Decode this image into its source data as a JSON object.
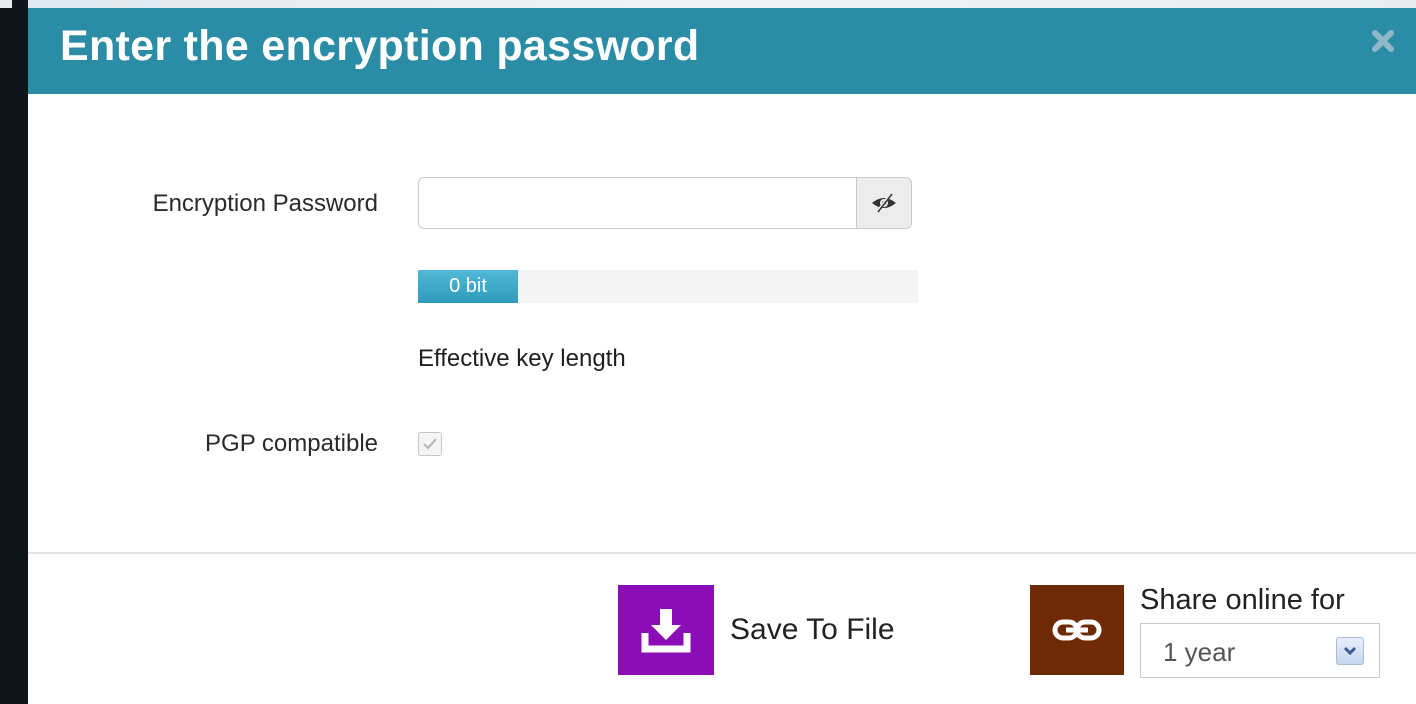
{
  "dialog": {
    "title": "Enter the encryption password",
    "header_color": "#2b8ca6"
  },
  "form": {
    "password_label": "Encryption Password",
    "password_value": "",
    "password_placeholder": "",
    "strength": {
      "text": "0 bit",
      "fill_fraction": 0.2
    },
    "key_length_label": "Effective key length",
    "pgp_label": "PGP compatible",
    "pgp_checked": true,
    "pgp_disabled": true
  },
  "footer": {
    "save_label": "Save To File",
    "save_color": "#8a0db5",
    "share_label": "Share online for",
    "share_color": "#6e2a05",
    "duration_selected": "1 year"
  },
  "icons": {
    "close": "close-icon",
    "toggle_visibility": "eye-icon",
    "download": "download-icon",
    "link": "link-icon",
    "dropdown": "chevron-down-icon"
  }
}
